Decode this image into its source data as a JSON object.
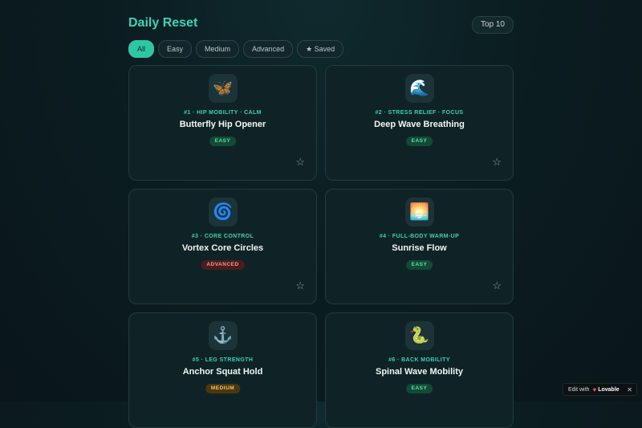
{
  "header": {
    "title": "Daily Reset",
    "badge": "Top 10"
  },
  "filters": [
    {
      "label": "All",
      "active": true
    },
    {
      "label": "Easy",
      "active": false
    },
    {
      "label": "Medium",
      "active": false
    },
    {
      "label": "Advanced",
      "active": false
    },
    {
      "label": "★ Saved",
      "active": false
    }
  ],
  "cards": [
    {
      "icon": "🦋",
      "icon_name": "butterfly-icon",
      "meta": "#1 · HIP MOBILITY · CALM",
      "name": "Butterfly Hip Opener",
      "difficulty": "EASY"
    },
    {
      "icon": "🌊",
      "icon_name": "wave-icon",
      "meta": "#2 · STRESS RELIEF · FOCUS",
      "name": "Deep Wave Breathing",
      "difficulty": "EASY"
    },
    {
      "icon": "🌀",
      "icon_name": "cyclone-icon",
      "meta": "#3 · CORE CONTROL",
      "name": "Vortex Core Circles",
      "difficulty": "ADVANCED"
    },
    {
      "icon": "🌅",
      "icon_name": "sunrise-icon",
      "meta": "#4 · FULL-BODY WARM-UP",
      "name": "Sunrise Flow",
      "difficulty": "EASY"
    },
    {
      "icon": "⚓",
      "icon_name": "anchor-icon",
      "meta": "#5 · LEG STRENGTH",
      "name": "Anchor Squat Hold",
      "difficulty": "MEDIUM"
    },
    {
      "icon": "🐍",
      "icon_name": "snake-icon",
      "meta": "#6 · BACK MOBILITY",
      "name": "Spinal Wave Mobility",
      "difficulty": "EASY"
    }
  ],
  "star_glyph": "☆",
  "lovable": {
    "prefix": "Edit with",
    "heart": "♥",
    "brand": "Lovable",
    "close": "✕"
  },
  "colors": {
    "accent": "#2ec7a6",
    "title": "#3ed2b8",
    "easy": "#58e3a8",
    "advanced": "#f59a8f",
    "medium": "#f2c45c"
  }
}
